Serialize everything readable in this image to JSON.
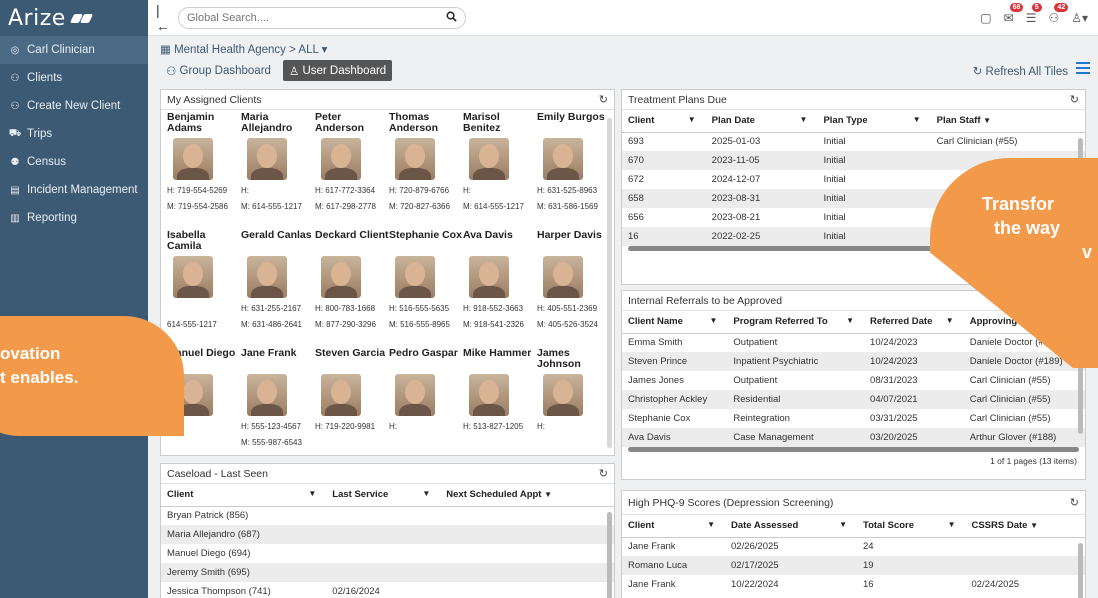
{
  "app": {
    "logo": "Arize"
  },
  "sidebar": {
    "items": [
      {
        "icon": "user-circle-icon",
        "glyph": "◎",
        "label": "Carl Clinician"
      },
      {
        "icon": "users-icon",
        "glyph": "⚇",
        "label": "Clients"
      },
      {
        "icon": "users-icon",
        "glyph": "⚇",
        "label": "Create New Client"
      },
      {
        "icon": "car-icon",
        "glyph": "⛟",
        "label": "Trips"
      },
      {
        "icon": "census-icon",
        "glyph": "⚉",
        "label": "Census"
      },
      {
        "icon": "clipboard-icon",
        "glyph": "▤",
        "label": "Incident Management"
      },
      {
        "icon": "bar-chart-icon",
        "glyph": "▥",
        "label": "Reporting"
      }
    ]
  },
  "topbar": {
    "search_placeholder": "Global Search....",
    "badges": [
      "68",
      "5",
      "42"
    ]
  },
  "breadcrumb": "Mental Health Agency > ALL",
  "tabs": {
    "group": "Group Dashboard",
    "user": "User Dashboard"
  },
  "refresh_all": "Refresh All Tiles",
  "assigned": {
    "title": "My Assigned Clients",
    "clients": [
      {
        "name": "Benjamin Adams",
        "phone": "H: 719-554-5269",
        "mobile": "M: 719-554-2586"
      },
      {
        "name": "Maria Allejandro",
        "phone": "H:",
        "mobile": "M: 614-555-1217"
      },
      {
        "name": "Peter Anderson",
        "phone": "H: 617-772-3364",
        "mobile": "M: 617-298-2778"
      },
      {
        "name": "Thomas Anderson",
        "phone": "H: 720-879-6766",
        "mobile": "M: 720-827-6366"
      },
      {
        "name": "Marisol Benitez",
        "phone": "H:",
        "mobile": "M: 614-555-1217"
      },
      {
        "name": "Emily Burgos",
        "phone": "H: 631-525-8963",
        "mobile": "M: 631-586-1569"
      },
      {
        "name": "Isabella Camila",
        "phone": "",
        "mobile": "614-555-1217"
      },
      {
        "name": "Gerald Canlas",
        "phone": "H: 631-255-2167",
        "mobile": "M: 631-486-2641"
      },
      {
        "name": "Deckard Client",
        "phone": "H: 800-783-1668",
        "mobile": "M: 877-290-3296"
      },
      {
        "name": "Stephanie Cox",
        "phone": "H: 516-555-5635",
        "mobile": "M: 516-555-8965"
      },
      {
        "name": "Ava Davis",
        "phone": "H: 918-552-3663",
        "mobile": "M: 918-541-2326"
      },
      {
        "name": "Harper Davis",
        "phone": "H: 405-551-2369",
        "mobile": "M: 405-526-3524"
      },
      {
        "name": "Manuel Diego",
        "phone": "H:",
        "mobile": ""
      },
      {
        "name": "Jane Frank",
        "phone": "H: 555-123-4567",
        "mobile": "M: 555-987-6543"
      },
      {
        "name": "Steven Garcia",
        "phone": "H: 719-220-9981",
        "mobile": ""
      },
      {
        "name": "Pedro Gaspar",
        "phone": "H:",
        "mobile": ""
      },
      {
        "name": "Mike Hammer",
        "phone": "H: 513-827-1205",
        "mobile": ""
      },
      {
        "name": "James Johnson",
        "phone": "H:",
        "mobile": ""
      }
    ]
  },
  "caseload": {
    "title": "Caseload - Last Seen",
    "headers": [
      "Client",
      "Last Service",
      "Next Scheduled Appt"
    ],
    "rows": [
      [
        "Bryan Patrick (856)",
        "",
        ""
      ],
      [
        "Maria Allejandro (687)",
        "",
        ""
      ],
      [
        "Manuel Diego (694)",
        "",
        ""
      ],
      [
        "Jeremy Smith (695)",
        "",
        ""
      ],
      [
        "Jessica Thompson (741)",
        "02/16/2024",
        ""
      ]
    ]
  },
  "treatment": {
    "title": "Treatment Plans Due",
    "headers": [
      "Client",
      "Plan Date",
      "Plan Type",
      "Plan Staff"
    ],
    "rows": [
      [
        "693",
        "2025-01-03",
        "Initial",
        "Carl Clinician (#55)"
      ],
      [
        "670",
        "2023-11-05",
        "Initial",
        ""
      ],
      [
        "672",
        "2024-12-07",
        "Initial",
        ""
      ],
      [
        "658",
        "2023-08-31",
        "Initial",
        ""
      ],
      [
        "656",
        "2023-08-21",
        "Initial",
        ""
      ],
      [
        "16",
        "2022-02-25",
        "Initial",
        ""
      ]
    ]
  },
  "referrals": {
    "title": "Internal Referrals to be Approved",
    "headers": [
      "Client Name",
      "Program Referred To",
      "Referred Date",
      "Approving Staff"
    ],
    "rows": [
      [
        "Emma Smith",
        "Outpatient",
        "10/24/2023",
        "Daniele Doctor (#189)"
      ],
      [
        "Steven Prince",
        "Inpatient Psychiatric",
        "10/24/2023",
        "Daniele Doctor (#189)"
      ],
      [
        "James Jones",
        "Outpatient",
        "08/31/2023",
        "Carl Clinician (#55)"
      ],
      [
        "Christopher Ackley",
        "Residential",
        "04/07/2021",
        "Carl Clinician (#55)"
      ],
      [
        "Stephanie Cox",
        "Reintegration",
        "03/31/2025",
        "Carl Clinician (#55)"
      ],
      [
        "Ava Davis",
        "Case Management",
        "03/20/2025",
        "Arthur Glover (#188)"
      ]
    ],
    "pager": "1 of 1 pages (13 items)"
  },
  "phq": {
    "title": "High PHQ-9 Scores (Depression Screening)",
    "headers": [
      "Client",
      "Date Assessed",
      "Total Score",
      "CSSRS Date"
    ],
    "rows": [
      [
        "Jane Frank",
        "02/26/2025",
        "24",
        ""
      ],
      [
        "Romano Luca",
        "02/17/2025",
        "19",
        ""
      ],
      [
        "Jane Frank",
        "10/22/2024",
        "16",
        "02/24/2025"
      ]
    ]
  },
  "overlays": {
    "left_lines": [
      "ovation",
      "t enables."
    ],
    "right_lines": [
      "Transfor",
      "the way",
      "v"
    ]
  },
  "colors": {
    "sidebar": "#3d5a74",
    "accent_orange": "#f2994a",
    "badge_red": "#d9343b",
    "link_blue": "#1f78d1"
  }
}
